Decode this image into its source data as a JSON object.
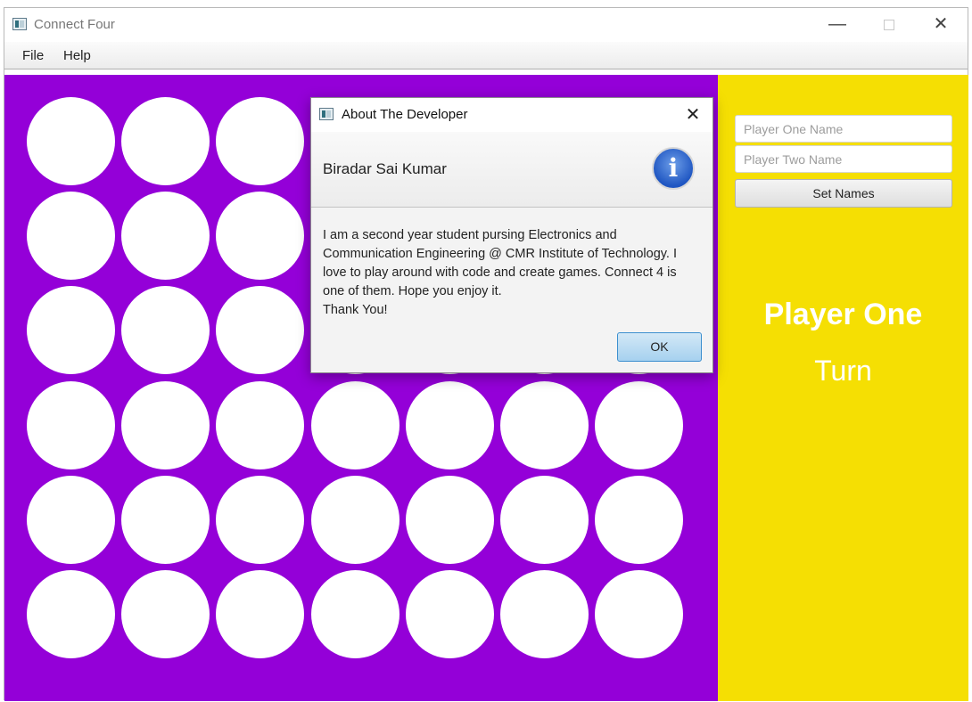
{
  "window": {
    "title": "Connect Four",
    "controls": {
      "minimize": "—",
      "maximize": "",
      "close": "✕"
    }
  },
  "menu": {
    "file": "File",
    "help": "Help"
  },
  "board": {
    "columns": 7,
    "rows": 6,
    "background_color": "#9400d8",
    "empty_disc_color": "#ffffff"
  },
  "side_panel": {
    "background_color": "#f5df03",
    "player_one_placeholder": "Player One Name",
    "player_two_placeholder": "Player Two Name",
    "set_names_label": "Set Names",
    "current_player": "Player One",
    "turn_label": "Turn"
  },
  "dialog": {
    "title": "About The Developer",
    "close": "✕",
    "heading": "Biradar Sai Kumar",
    "icon": "info-icon",
    "body_lines": [
      "I am a second year student pursing Electronics and",
      "Communication Engineering @ CMR Institute of Technology. I",
      "love to play around with code and create games. Connect 4 is",
      "one of them. Hope you enjoy it.",
      "Thank You!"
    ],
    "ok_label": "OK"
  }
}
